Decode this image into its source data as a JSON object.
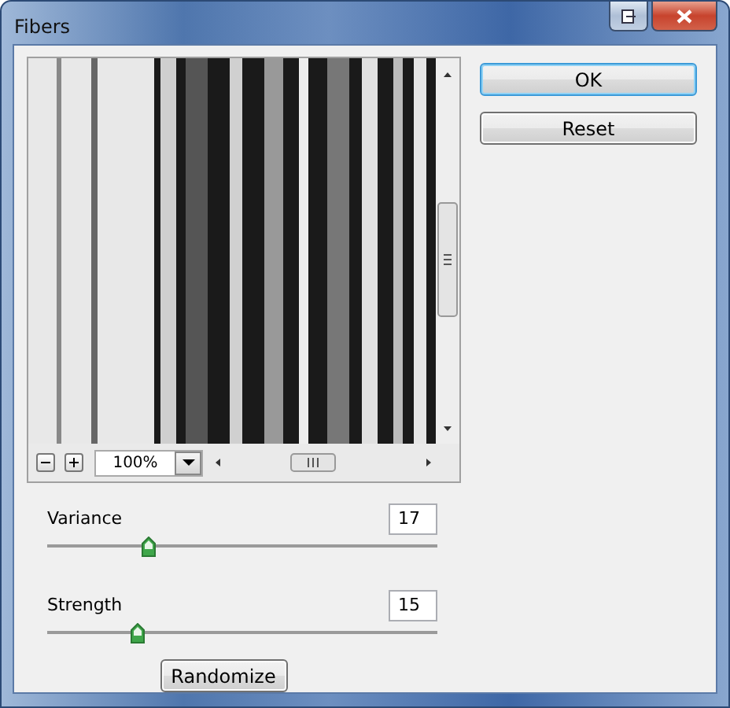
{
  "window": {
    "title": "Fibers"
  },
  "preview": {
    "zoom": "100%"
  },
  "buttons": [
    {
      "label": "OK",
      "default": true
    },
    {
      "label": "Reset",
      "default": false
    }
  ],
  "sliders": [
    {
      "label": "Variance",
      "value": "17",
      "level": 0.26
    },
    {
      "label": "Strength",
      "value": "15",
      "level": 0.23
    }
  ],
  "randomize": {
    "label": "Randomize"
  }
}
